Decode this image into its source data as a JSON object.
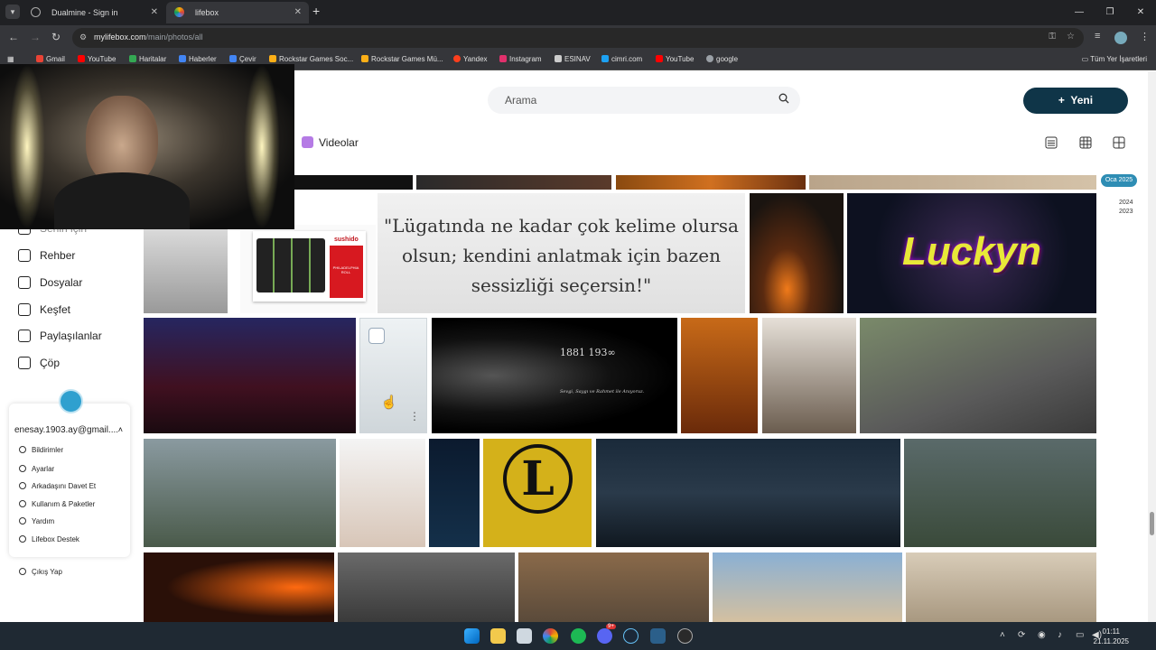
{
  "browser": {
    "tabs": [
      {
        "label": "Dualmine - Sign in",
        "active": false
      },
      {
        "label": "lifebox",
        "active": true
      }
    ],
    "url": {
      "host": "mylifebox.com",
      "path": "/main/photos/all"
    },
    "bookmarks": [
      {
        "label": "Gmail",
        "color": "#ea4335"
      },
      {
        "label": "YouTube",
        "color": "#ff0000"
      },
      {
        "label": "Haritalar",
        "color": "#34a853"
      },
      {
        "label": "Haberler",
        "color": "#4285f4"
      },
      {
        "label": "Çevir",
        "color": "#4285f4"
      },
      {
        "label": "Rockstar Games Soc...",
        "color": "#fcaf17"
      },
      {
        "label": "Rockstar Games Mü...",
        "color": "#fcaf17"
      },
      {
        "label": "Yandex",
        "color": "#fc3f1d"
      },
      {
        "label": "Instagram",
        "color": "#e1306c"
      },
      {
        "label": "ESINAV",
        "color": "#cccccc"
      },
      {
        "label": "cimri.com",
        "color": "#1da1f2"
      },
      {
        "label": "YouTube",
        "color": "#ff0000"
      },
      {
        "label": "google",
        "color": "#9aa0a6"
      }
    ],
    "all_bookmarks": "Tüm Yer İşaretleri"
  },
  "header": {
    "search_placeholder": "Arama",
    "new_button": "Yeni",
    "new_button_plus": "+"
  },
  "filter": {
    "videos_label": "Videolar"
  },
  "sidebar": {
    "partial_item": "Senin için",
    "items": [
      {
        "label": "Rehber",
        "icon": "contacts-icon"
      },
      {
        "label": "Dosyalar",
        "icon": "files-icon"
      },
      {
        "label": "Keşfet",
        "icon": "discover-icon"
      },
      {
        "label": "Paylaşılanlar",
        "icon": "shared-icon"
      },
      {
        "label": "Çöp",
        "icon": "trash-icon"
      }
    ]
  },
  "account": {
    "email": "enesay.1903.ay@gmail....",
    "menu": [
      {
        "label": "Bildirimler",
        "icon": "bell-icon"
      },
      {
        "label": "Ayarlar",
        "icon": "settings-icon"
      },
      {
        "label": "Arkadaşını Davet Et",
        "icon": "invite-icon"
      },
      {
        "label": "Kullanım & Paketler",
        "icon": "usage-icon"
      },
      {
        "label": "Yardım",
        "icon": "help-icon"
      },
      {
        "label": "Lifebox Destek",
        "icon": "phone-icon"
      }
    ],
    "logout": "Çıkış Yap"
  },
  "timeline": {
    "current": "Oca 2025",
    "years": [
      "2024",
      "2023"
    ]
  },
  "photos": {
    "quote": "\"Lügatında ne kadar çok kelime olursa olsun; kendini anlatmak için bazen sessizliği seçersin!\"",
    "lucky_text": "Luckyn",
    "sushi_brand": "sushido",
    "sushi_product": "PHILADELPHIA ROLL",
    "ataturk_date": "1881 193∞",
    "ataturk_caption": "Sevgi, Saygı ve Rahmet ile Anıyoruz."
  },
  "taskbar": {
    "time": "01:11",
    "date": "21.11.2025",
    "badge": "9+"
  }
}
